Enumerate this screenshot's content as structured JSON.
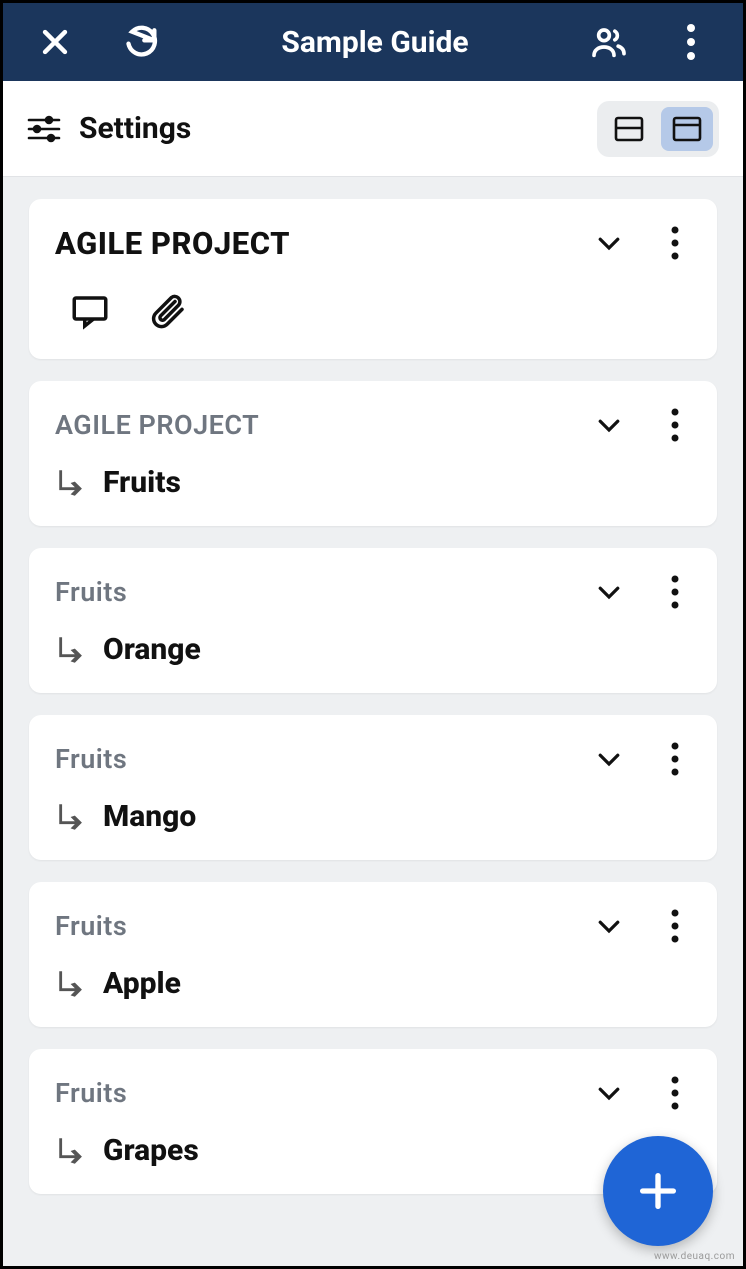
{
  "header": {
    "title": "Sample Guide"
  },
  "settings": {
    "label": "Settings"
  },
  "cards": {
    "root": {
      "title": "AGILE PROJECT"
    },
    "items": [
      {
        "parent": "AGILE PROJECT",
        "child": "Fruits"
      },
      {
        "parent": "Fruits",
        "child": "Orange"
      },
      {
        "parent": "Fruits",
        "child": "Mango"
      },
      {
        "parent": "Fruits",
        "child": "Apple"
      },
      {
        "parent": "Fruits",
        "child": "Grapes"
      }
    ]
  },
  "watermark": "www.deuaq.com"
}
